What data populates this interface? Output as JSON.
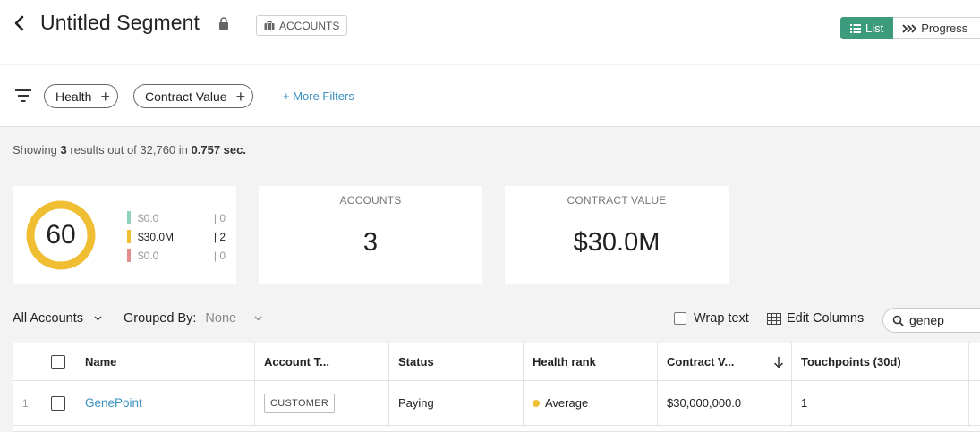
{
  "header": {
    "title": "Untitled Segment",
    "entity_badge": "ACCOUNTS",
    "view_toggle": {
      "list_label": "List",
      "progress_label": "Progress"
    }
  },
  "filters": {
    "chips": [
      {
        "label": "Health"
      },
      {
        "label": "Contract Value"
      }
    ],
    "more_label": "+ More Filters"
  },
  "results": {
    "prefix": "Showing",
    "count": "3",
    "middle": "results out of 32,760 in",
    "time": "0.757 sec."
  },
  "health_card": {
    "score": "60",
    "ring_color": "#f0be32",
    "legend": [
      {
        "value": "$0.0",
        "count": "| 0",
        "color": "#8fd3bf"
      },
      {
        "value": "$30.0M",
        "count": "| 2",
        "color": "#f0be32"
      },
      {
        "value": "$0.0",
        "count": "| 0",
        "color": "#e58e8e"
      }
    ]
  },
  "metrics": [
    {
      "label": "ACCOUNTS",
      "value": "3"
    },
    {
      "label": "CONTRACT VALUE",
      "value": "$30.0M"
    }
  ],
  "toolbar": {
    "all_accounts": "All Accounts",
    "grouped_by_label": "Grouped By:",
    "grouped_by_value": "None",
    "wrap_text": "Wrap text",
    "edit_columns": "Edit Columns",
    "search_value": "genep"
  },
  "table": {
    "columns": [
      "Name",
      "Account T...",
      "Status",
      "Health rank",
      "Contract V...",
      "Touchpoints (30d)"
    ],
    "rows": [
      {
        "index": "1",
        "name": "GenePoint",
        "account_type": "CUSTOMER",
        "status": "Paying",
        "health_rank": "Average",
        "health_color": "#f0be32",
        "contract_value": "$30,000,000.0",
        "touchpoints": "1"
      }
    ]
  },
  "colors": {
    "accent": "#3c9b7d",
    "link": "#3a90c2"
  }
}
